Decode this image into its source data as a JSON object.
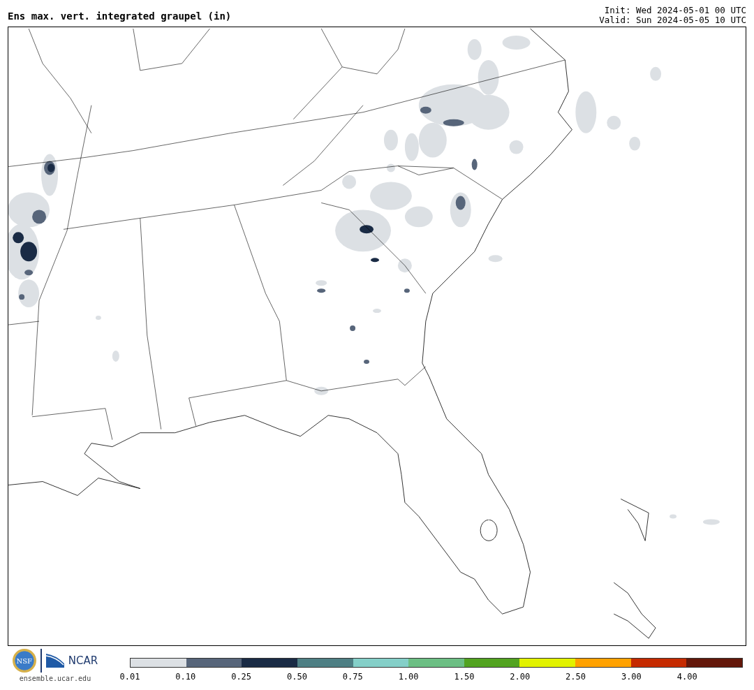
{
  "title": "Ens max. vert. integrated graupel (in)",
  "init": "Init: Wed 2024-05-01 00 UTC",
  "valid": "Valid: Sun 2024-05-05 10 UTC",
  "logos": {
    "nsf": "NSF",
    "ncar": "NCAR",
    "site": "ensemble.ucar.edu"
  },
  "colorbar": {
    "segments": [
      {
        "color": "#dce0e4"
      },
      {
        "color": "#57657a"
      },
      {
        "color": "#1a2b45"
      },
      {
        "color": "#4e7f84"
      },
      {
        "color": "#84cfc8"
      },
      {
        "color": "#6cbf84"
      },
      {
        "color": "#52a320"
      },
      {
        "color": "#e2f200"
      },
      {
        "color": "#ffa100"
      },
      {
        "color": "#c52a00"
      },
      {
        "color": "#63170a"
      }
    ],
    "labels": [
      "0.01",
      "0.10",
      "0.25",
      "0.50",
      "0.75",
      "1.00",
      "1.50",
      "2.00",
      "2.50",
      "3.00",
      "4.00"
    ]
  }
}
